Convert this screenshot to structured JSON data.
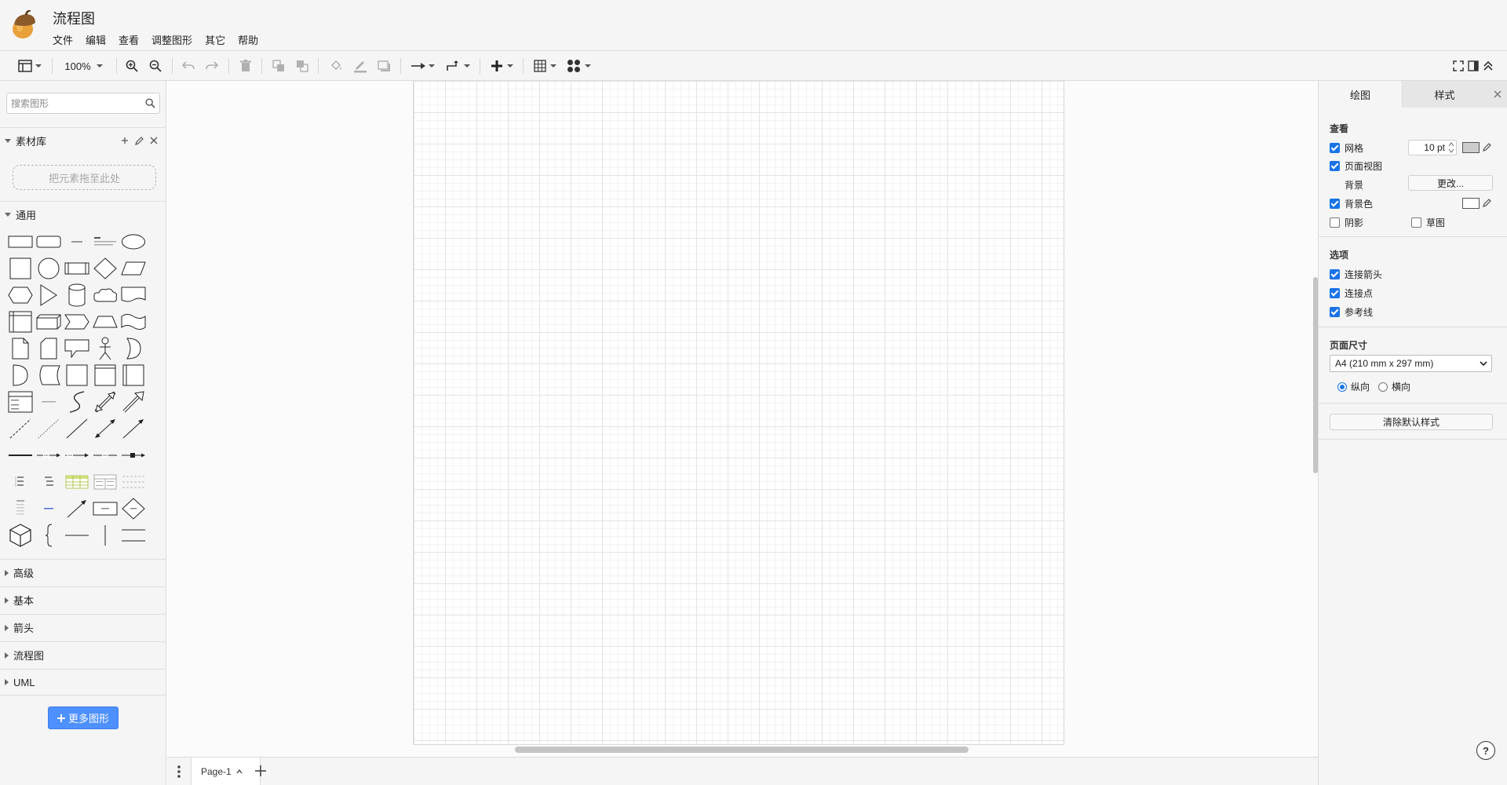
{
  "app": {
    "title": "流程图"
  },
  "menu": [
    "文件",
    "编辑",
    "查看",
    "调整图形",
    "其它",
    "帮助"
  ],
  "toolbar": {
    "zoom": "100%"
  },
  "sidebar": {
    "search_placeholder": "搜索图形",
    "library_title": "素材库",
    "dropzone_label": "把元素拖至此处",
    "general_title": "通用",
    "sections": [
      "高级",
      "基本",
      "箭头",
      "流程图",
      "UML"
    ],
    "more_shapes_label": "更多图形"
  },
  "pages": {
    "current": "Page-1"
  },
  "panel": {
    "tabs": [
      "绘图",
      "样式"
    ],
    "view_title": "查看",
    "grid_label": "网格",
    "grid_size": "10 pt",
    "page_view_label": "页面视图",
    "background_label": "背景",
    "change_label": "更改...",
    "background_color_label": "背景色",
    "shadow_label": "阴影",
    "sketch_label": "草图",
    "options_title": "选项",
    "connection_arrows_label": "连接箭头",
    "connection_points_label": "连接点",
    "guides_label": "参考线",
    "page_size_title": "页面尺寸",
    "page_size_value": "A4 (210 mm x 297 mm)",
    "portrait_label": "纵向",
    "landscape_label": "横向",
    "clear_style_label": "清除默认样式",
    "grid_checked": true,
    "page_view_checked": true,
    "background_color_checked": true,
    "shadow_checked": false,
    "sketch_checked": false,
    "orientation": "portrait"
  },
  "colors": {
    "accent": "#4d90fe",
    "checkbox": "#1a73e8",
    "grid_color": "#cccccc",
    "background_color": "#ffffff"
  }
}
